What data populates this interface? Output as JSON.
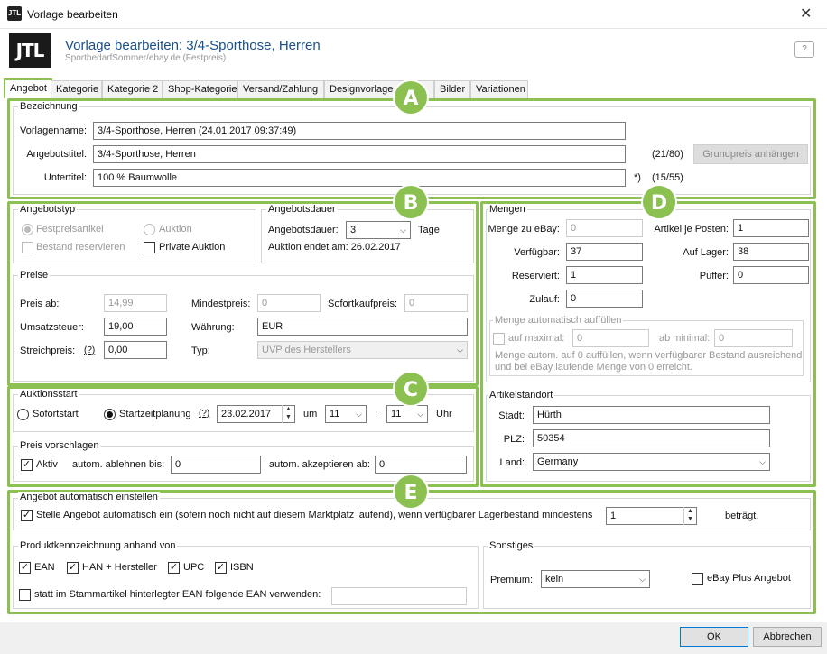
{
  "window": {
    "title": "Vorlage bearbeiten",
    "close": "✕"
  },
  "header": {
    "logo": "JTL",
    "title": "Vorlage bearbeiten: 3/4-Sporthose, Herren",
    "subtitle": "SportbedarfSommer/ebay.de (Festpreis)",
    "help_glyph": "?"
  },
  "tabs": [
    "Angebot",
    "Kategorie",
    "Kategorie 2",
    "Shop-Kategorie",
    "Versand/Zahlung",
    "Designvorlage",
    "Bilder",
    "Variationen"
  ],
  "badges": {
    "a": "A",
    "b": "B",
    "c": "C",
    "d": "D",
    "e": "E"
  },
  "bezeichnung": {
    "section": "Bezeichnung",
    "vorlagenname_label": "Vorlagenname:",
    "vorlagenname_value": "3/4-Sporthose, Herren  (24.01.2017 09:37:49)",
    "angebotstitel_label": "Angebotstitel:",
    "angebotstitel_value": "3/4-Sporthose, Herren",
    "angebotstitel_count": "(21/80)",
    "grundpreis_button": "Grundpreis anhängen",
    "untertitel_label": "Untertitel:",
    "untertitel_value": "100 % Baumwolle",
    "untertitel_note": "*)",
    "untertitel_count": "(15/55)"
  },
  "angebotstyp": {
    "section": "Angebotstyp",
    "festpreis": "Festpreisartikel",
    "auktion": "Auktion",
    "bestand": "Bestand reservieren",
    "private": "Private Auktion"
  },
  "angebotsdauer": {
    "section": "Angebotsdauer",
    "label": "Angebotsdauer:",
    "value": "3",
    "unit": "Tage",
    "end_text": "Auktion endet am: 26.02.2017"
  },
  "preise": {
    "section": "Preise",
    "preis_ab_label": "Preis ab:",
    "preis_ab_value": "14,99",
    "mindest_label": "Mindestpreis:",
    "mindest_value": "0",
    "sofort_label": "Sofortkaufpreis:",
    "sofort_value": "0",
    "ust_label": "Umsatzsteuer:",
    "ust_value": "19,00",
    "waehrung_label": "Währung:",
    "waehrung_value": "EUR",
    "streich_label": "Streichpreis:",
    "help": "(?)",
    "streich_value": "0,00",
    "typ_label": "Typ:",
    "typ_value": "UVP des Herstellers"
  },
  "auktionsstart": {
    "section": "Auktionsstart",
    "sofort": "Sofortstart",
    "planung": "Startzeitplanung",
    "help": "(?)",
    "date": "23.02.2017",
    "um": "um",
    "hour": "11",
    "colon": ":",
    "minute": "11",
    "uhr": "Uhr"
  },
  "preis_vorschlagen": {
    "section": "Preis vorschlagen",
    "aktiv": "Aktiv",
    "ablehnen_label": "autom. ablehnen bis:",
    "ablehnen_value": "0",
    "akzept_label": "autom. akzeptieren ab:",
    "akzept_value": "0"
  },
  "mengen": {
    "section": "Mengen",
    "menge_ebay_label": "Menge zu eBay:",
    "menge_ebay_value": "0",
    "artikel_je_posten_label": "Artikel je Posten:",
    "artikel_je_posten_value": "1",
    "verfuegbar_label": "Verfügbar:",
    "verfuegbar_value": "37",
    "auf_lager_label": "Auf Lager:",
    "auf_lager_value": "38",
    "reserviert_label": "Reserviert:",
    "reserviert_value": "1",
    "puffer_label": "Puffer:",
    "puffer_value": "0",
    "zulauf_label": "Zulauf:",
    "zulauf_value": "0",
    "auto_section": "Menge automatisch auffüllen",
    "auf_maximal_label": "auf maximal:",
    "auf_maximal_value": "0",
    "ab_minimal_label": "ab minimal:",
    "ab_minimal_value": "0",
    "auto_note_1": "Menge autom. auf 0 auffüllen, wenn verfügbarer Bestand ausreichend",
    "auto_note_2": "und bei eBay laufende Menge von 0 erreicht."
  },
  "artikelstandort": {
    "section": "Artikelstandort",
    "stadt_label": "Stadt:",
    "stadt_value": "Hürth",
    "plz_label": "PLZ:",
    "plz_value": "50354",
    "land_label": "Land:",
    "land_value": "Germany"
  },
  "auto_einstellen": {
    "section": "Angebot automatisch einstellen",
    "text": "Stelle Angebot automatisch ein (sofern noch nicht auf diesem Marktplatz laufend), wenn verfügbarer Lagerbestand mindestens",
    "value": "1",
    "suffix": "beträgt."
  },
  "produkt": {
    "section": "Produktkennzeichnung anhand von",
    "ean": "EAN",
    "han": "HAN + Hersteller",
    "upc": "UPC",
    "isbn": "ISBN",
    "stamm": "statt im Stammartikel hinterlegter EAN folgende EAN verwenden:"
  },
  "sonstiges": {
    "section": "Sonstiges",
    "premium_label": "Premium:",
    "premium_value": "kein",
    "ebay_plus": "eBay Plus Angebot"
  },
  "footer": {
    "ok": "OK",
    "cancel": "Abbrechen"
  },
  "glyphs": {
    "check": "✓",
    "arrow": "⌵",
    "up": "▲",
    "down": "▼"
  }
}
